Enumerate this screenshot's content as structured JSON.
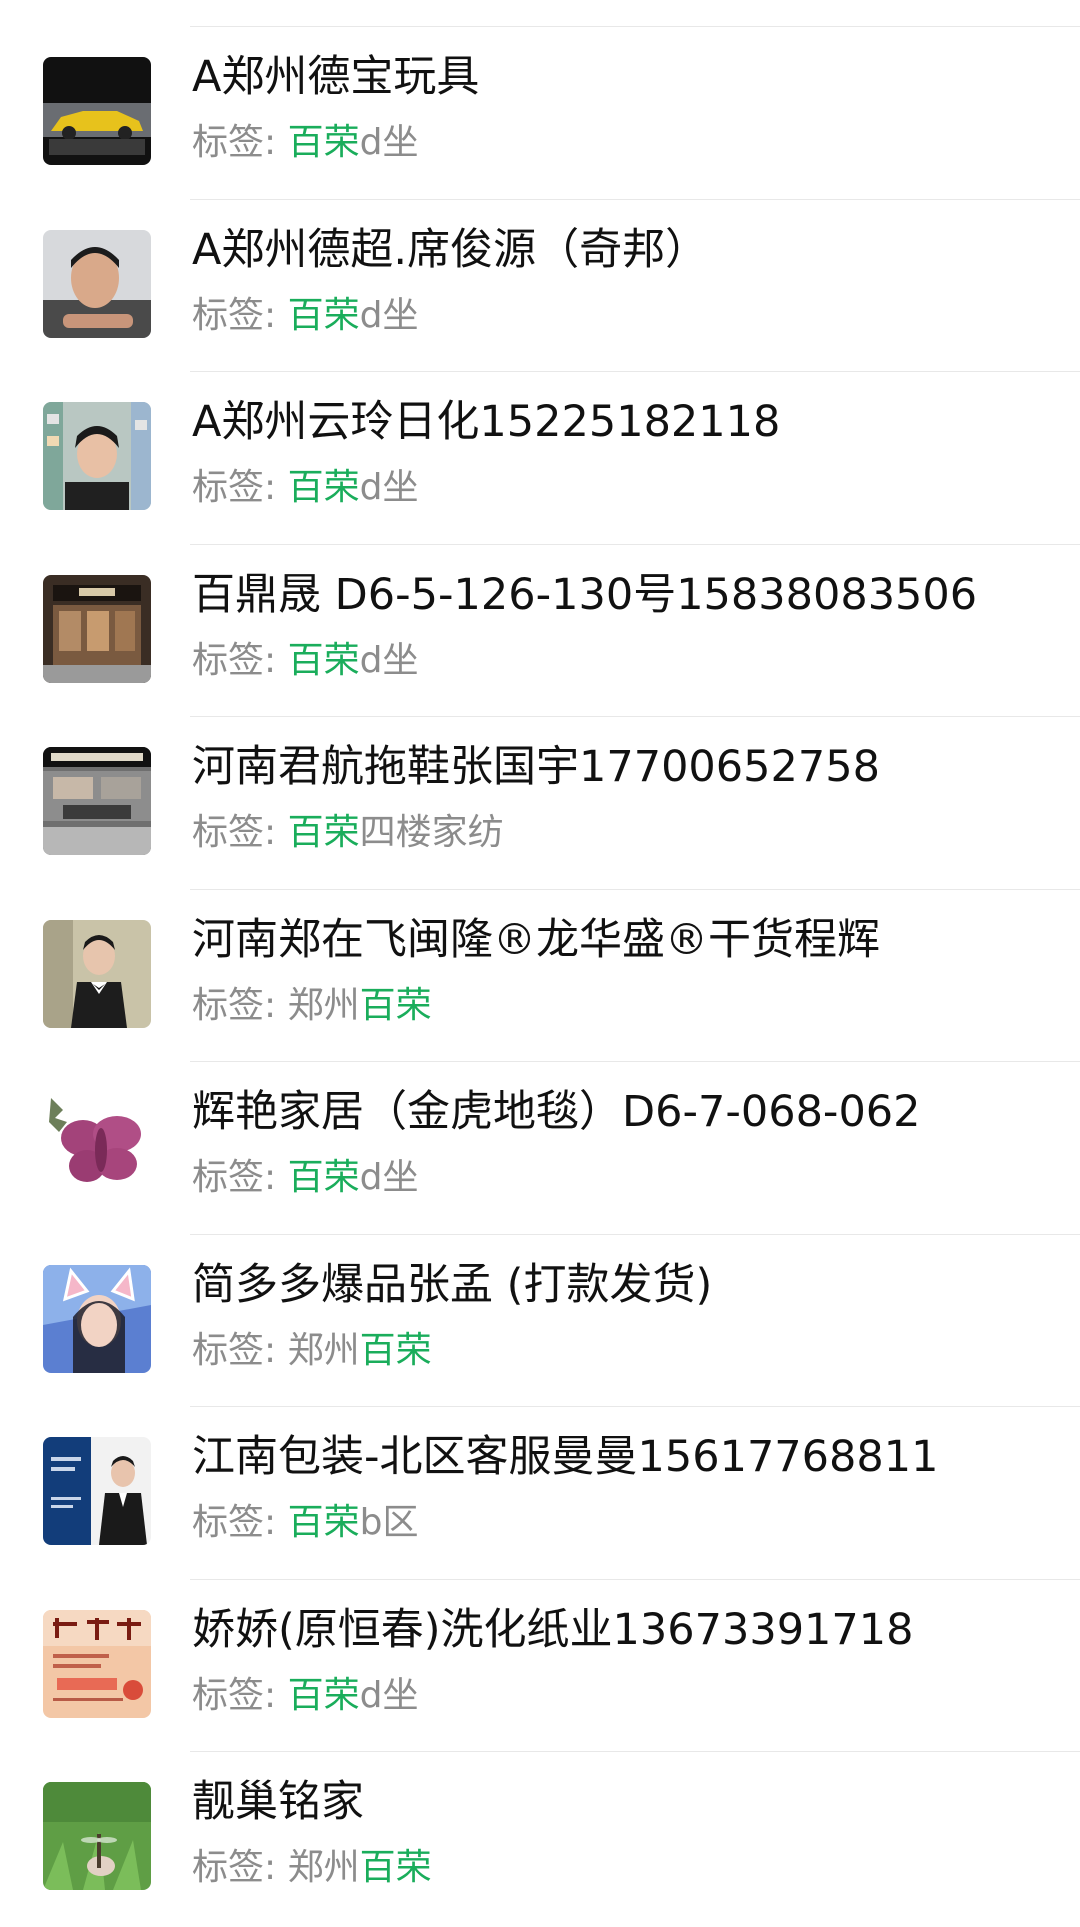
{
  "contacts": [
    {
      "name": "A郑州德宝玩具",
      "tag_label": "标签:",
      "tag_pre": "",
      "tag_hl": "百荣",
      "tag_post": "d坐",
      "avatar": "yellow-sports-car"
    },
    {
      "name": "A郑州德超.席俊源（奇邦）",
      "tag_label": "标签:",
      "tag_pre": "",
      "tag_hl": "百荣",
      "tag_post": "d坐",
      "avatar": "man-portrait"
    },
    {
      "name": "A郑州云玲日化15225182118",
      "tag_label": "标签:",
      "tag_pre": "",
      "tag_hl": "百荣",
      "tag_post": "d坐",
      "avatar": "woman-in-shop"
    },
    {
      "name": "百鼎晟 D6-5-126-130号15838083506",
      "tag_label": "标签:",
      "tag_pre": "",
      "tag_hl": "百荣",
      "tag_post": "d坐",
      "avatar": "storefront"
    },
    {
      "name": "河南君航拖鞋张国宇17700652758",
      "tag_label": "标签:",
      "tag_pre": "",
      "tag_hl": "百荣",
      "tag_post": "四楼家纺",
      "avatar": "shoe-store"
    },
    {
      "name": "河南郑在飞闽隆®龙华盛®干货程辉",
      "tag_label": "标签:",
      "tag_pre": "郑州",
      "tag_hl": "百荣",
      "tag_post": "",
      "avatar": "man-bowtie"
    },
    {
      "name": "辉艳家居（金虎地毯）D6-7-068-062",
      "tag_label": "标签:",
      "tag_pre": "",
      "tag_hl": "百荣",
      "tag_post": "d坐",
      "avatar": "butterfly-flower"
    },
    {
      "name": "简多多爆品张孟 (打款发货)",
      "tag_label": "标签:",
      "tag_pre": "郑州",
      "tag_hl": "百荣",
      "tag_post": "",
      "avatar": "woman-cat-ears"
    },
    {
      "name": "江南包装-北区客服曼曼15617768811",
      "tag_label": "标签:",
      "tag_pre": "",
      "tag_hl": "百荣",
      "tag_post": "b区",
      "avatar": "business-card"
    },
    {
      "name": "娇娇(原恒春)洗化纸业13673391718",
      "tag_label": "标签:",
      "tag_pre": "",
      "tag_hl": "百荣",
      "tag_post": "d坐",
      "avatar": "calligraphy-card"
    },
    {
      "name": "靓巢铭家",
      "tag_label": "标签:",
      "tag_pre": "郑州",
      "tag_hl": "百荣",
      "tag_post": "",
      "avatar": "dragonfly-grass"
    }
  ],
  "colors": {
    "accent_green": "#1aad5b",
    "tag_gray": "#8c8c8c",
    "divider": "#e8e8e8"
  }
}
